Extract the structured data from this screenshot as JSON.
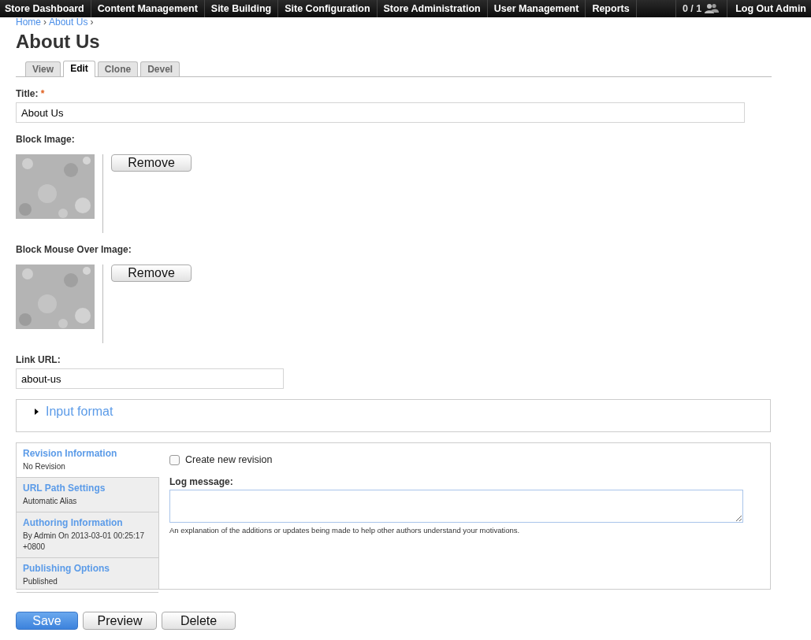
{
  "top_menu": {
    "items": [
      {
        "label": "Store Dashboard"
      },
      {
        "label": "Content Management"
      },
      {
        "label": "Site Building"
      },
      {
        "label": "Site Configuration"
      },
      {
        "label": "Store Administration"
      },
      {
        "label": "User Management"
      },
      {
        "label": "Reports"
      }
    ],
    "user_count": "0 / 1",
    "logout": "Log Out Admin"
  },
  "breadcrumb": [
    "Home",
    "About Us"
  ],
  "breadcrumb_separator": "›",
  "page_title": "About Us",
  "tabs": [
    {
      "label": "View",
      "selected": false
    },
    {
      "label": "Edit",
      "selected": true
    },
    {
      "label": "Clone",
      "selected": false
    },
    {
      "label": "Devel",
      "selected": false
    }
  ],
  "title_field": {
    "label": "Title:",
    "required_mark": "*",
    "value": "About Us"
  },
  "image_fields": [
    {
      "label": "Block Image:",
      "button": "Remove"
    },
    {
      "label": "Block Mouse Over Image:",
      "button": "Remove"
    }
  ],
  "link_url": {
    "label": "Link URL:",
    "value": "about-us"
  },
  "input_format": {
    "label": "Input format",
    "expanded": false
  },
  "vertical_tabs": [
    {
      "title": "Revision Information",
      "summary": "No Revision",
      "selected": true
    },
    {
      "title": "URL Path Settings",
      "summary": "Automatic Alias",
      "selected": false
    },
    {
      "title": "Authoring Information",
      "summary": "By Admin On 2013-03-01 00:25:17 +0800",
      "selected": false
    },
    {
      "title": "Publishing Options",
      "summary": "Published",
      "selected": false
    }
  ],
  "revision_pane": {
    "checkbox": {
      "label": "Create new revision",
      "checked": false
    },
    "log_label": "Log message:",
    "log_description": "An explanation of the additions or updates being made to help other authors understand your motivations."
  },
  "buttons": [
    {
      "label": "Save",
      "kind": "primary"
    },
    {
      "label": "Preview",
      "kind": "default"
    },
    {
      "label": "Delete",
      "kind": "default"
    }
  ]
}
